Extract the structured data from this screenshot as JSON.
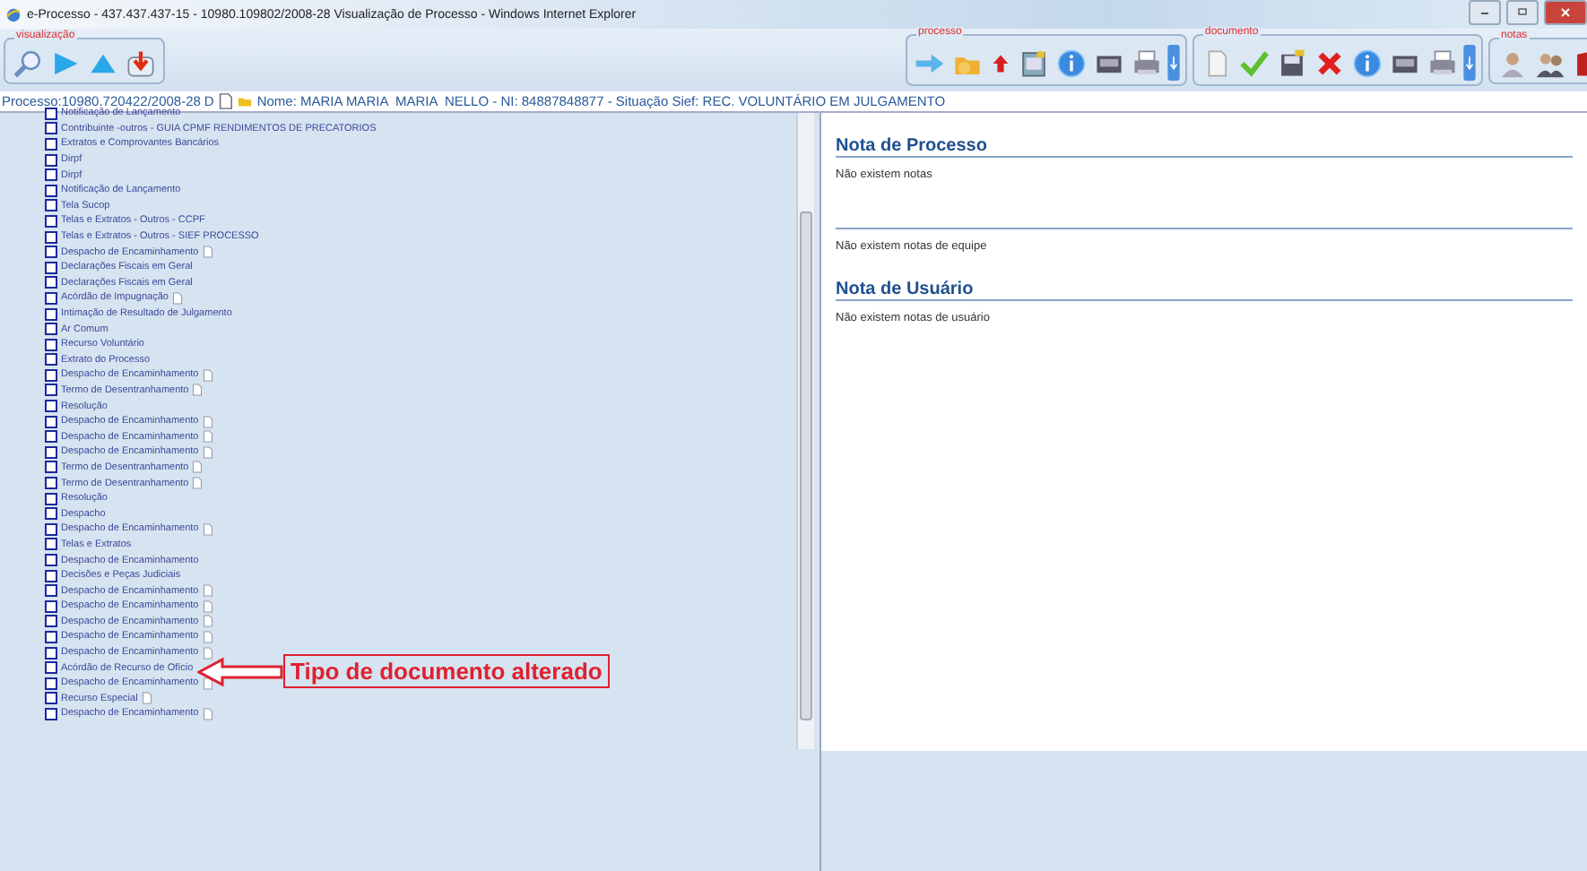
{
  "window": {
    "title": "e-Processo -  437.437.437-15 - 10980.109802/2008-28  Visualização de Processo - Windows Internet Explorer"
  },
  "toolbar": {
    "groups": [
      {
        "title": "visualização"
      },
      {
        "title": "processo"
      },
      {
        "title": "documento"
      },
      {
        "title": "notas"
      }
    ]
  },
  "process_line": {
    "process": "Processo:10980.720422/2008-28",
    "flag": "D",
    "details": "Nome: MARIA MARIA  MARIA  NELLO - NI: 84887848877 - Situação Sief: REC. VOLUNTÁRIO EM JULGAMENTO"
  },
  "tree": {
    "items": [
      {
        "label": "Notificação de Lançamento",
        "checked": false,
        "doc": false
      },
      {
        "label": "Contribuinte -outros - GUIA CPMF RENDIMENTOS DE PRECATORIOS",
        "checked": false,
        "doc": false
      },
      {
        "label": "Extratos e Comprovantes Bancários",
        "checked": false,
        "doc": false
      },
      {
        "label": "Dirpf",
        "checked": false,
        "doc": false
      },
      {
        "label": "Dirpf",
        "checked": false,
        "doc": false
      },
      {
        "label": "Notificação de Lançamento",
        "checked": false,
        "doc": false
      },
      {
        "label": "Tela Sucop",
        "checked": false,
        "doc": false
      },
      {
        "label": "Telas e Extratos - Outros - CCPF",
        "checked": false,
        "doc": false
      },
      {
        "label": "Telas e Extratos - Outros - SIEF PROCESSO",
        "checked": false,
        "doc": false
      },
      {
        "label": "Despacho de Encaminhamento",
        "checked": false,
        "doc": true
      },
      {
        "label": "Declarações Fiscais em Geral",
        "checked": false,
        "doc": false
      },
      {
        "label": "Declarações Fiscais em Geral",
        "checked": false,
        "doc": false
      },
      {
        "label": "Acórdão de Impugnação",
        "checked": false,
        "doc": true
      },
      {
        "label": "Intimação de Resultado de Julgamento",
        "checked": false,
        "doc": false
      },
      {
        "label": "Ar Comum",
        "checked": false,
        "doc": false
      },
      {
        "label": "Recurso Voluntário",
        "checked": false,
        "doc": false
      },
      {
        "label": "Extrato do Processo",
        "checked": false,
        "doc": false
      },
      {
        "label": "Despacho de Encaminhamento",
        "checked": false,
        "doc": true
      },
      {
        "label": "Termo de Desentranhamento",
        "checked": false,
        "doc": true
      },
      {
        "label": "Resolução",
        "checked": false,
        "doc": false
      },
      {
        "label": "Despacho de Encaminhamento",
        "checked": false,
        "doc": true
      },
      {
        "label": "Despacho de Encaminhamento",
        "checked": false,
        "doc": true
      },
      {
        "label": "Despacho de Encaminhamento",
        "checked": false,
        "doc": true
      },
      {
        "label": "Termo de Desentranhamento",
        "checked": false,
        "doc": true
      },
      {
        "label": "Termo de Desentranhamento",
        "checked": false,
        "doc": true
      },
      {
        "label": "Resolução",
        "checked": false,
        "doc": false
      },
      {
        "label": "Despacho",
        "checked": false,
        "doc": false
      },
      {
        "label": "Despacho de Encaminhamento",
        "checked": false,
        "doc": true
      },
      {
        "label": "Telas e Extratos",
        "checked": false,
        "doc": false
      },
      {
        "label": "Despacho de Encaminhamento",
        "checked": false,
        "doc": false
      },
      {
        "label": "Decisões e Peças Judiciais",
        "checked": false,
        "doc": false
      },
      {
        "label": "Despacho de Encaminhamento",
        "checked": false,
        "doc": true
      },
      {
        "label": "Despacho de Encaminhamento",
        "checked": false,
        "doc": true
      },
      {
        "label": "Despacho de Encaminhamento",
        "checked": false,
        "doc": true
      },
      {
        "label": "Despacho de Encaminhamento",
        "checked": false,
        "doc": true
      },
      {
        "label": "Despacho de Encaminhamento",
        "checked": false,
        "doc": true
      },
      {
        "label": "Acórdão de Recurso de Ofício",
        "checked": false,
        "doc": false
      },
      {
        "label": "Despacho de Encaminhamento",
        "checked": false,
        "doc": true
      },
      {
        "label": "Recurso Especial",
        "checked": false,
        "doc": true
      },
      {
        "label": "Despacho de Encaminhamento",
        "checked": false,
        "doc": true
      }
    ]
  },
  "annotation": {
    "text": "Tipo de documento alterado"
  },
  "notes": {
    "sections": [
      {
        "heading": "Nota de Processo",
        "text": "Não existem notas"
      },
      {
        "text": "Não existem notas de equipe"
      },
      {
        "heading": "Nota de Usuário",
        "text": "Não existem notas de usuário"
      }
    ]
  }
}
